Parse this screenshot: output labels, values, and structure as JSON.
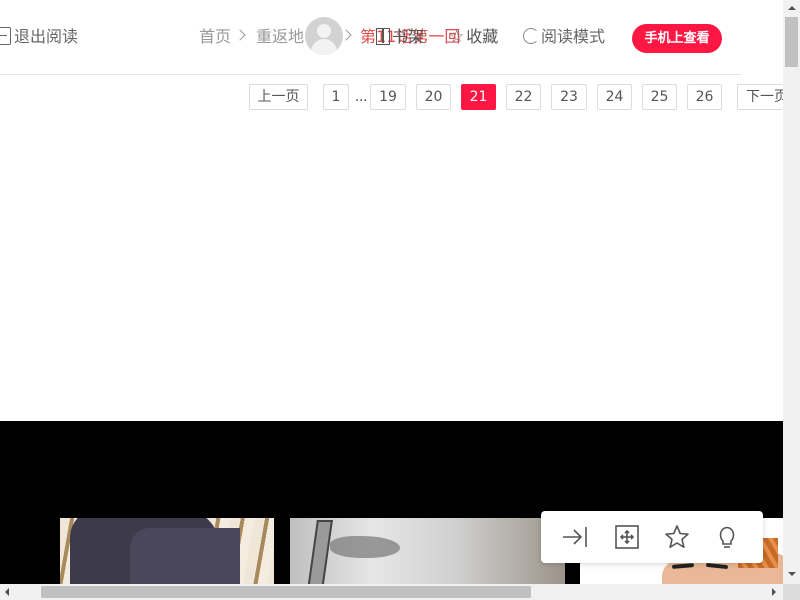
{
  "header": {
    "exit_label": "退出阅读",
    "breadcrumb": {
      "home": "首页",
      "comic": "重返地",
      "chapter": "第11话第一回"
    },
    "shelf_label": "书架",
    "favorite_label": "收藏",
    "read_mode_label": "阅读模式",
    "mobile_button": "手机上查看"
  },
  "pagination": {
    "prev": "上一页",
    "first": "1",
    "ellipsis": "...",
    "pages": [
      "19",
      "20",
      "21",
      "22",
      "23",
      "24",
      "25",
      "26"
    ],
    "current": "21",
    "next": "下一页"
  },
  "tools": [
    "jump-to-end-icon",
    "fit-screen-icon",
    "star-icon",
    "lightbulb-icon"
  ],
  "colors": {
    "accent": "#ff1744",
    "chapter_text": "#e04a4a"
  }
}
